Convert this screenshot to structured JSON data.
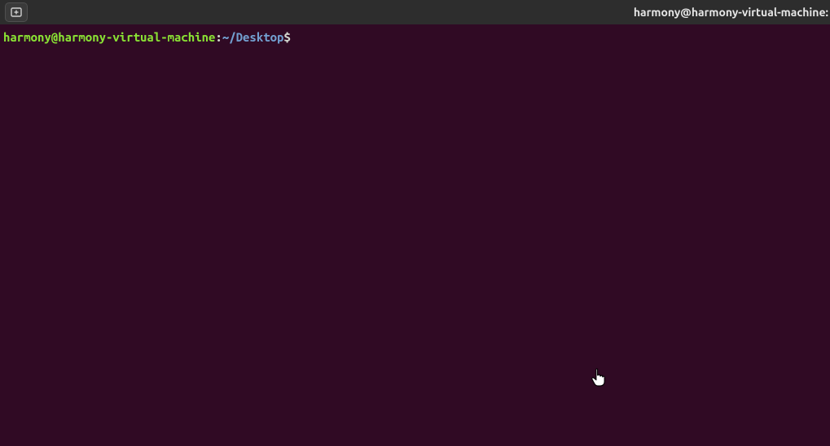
{
  "titlebar": {
    "title": "harmony@harmony-virtual-machine:"
  },
  "prompt": {
    "user_host": "harmony@harmony-virtual-machine",
    "sep": ":",
    "path": "~/Desktop",
    "symbol": "$"
  },
  "icons": {
    "new_tab": "new-tab-icon",
    "cursor": "hand-pointer"
  }
}
